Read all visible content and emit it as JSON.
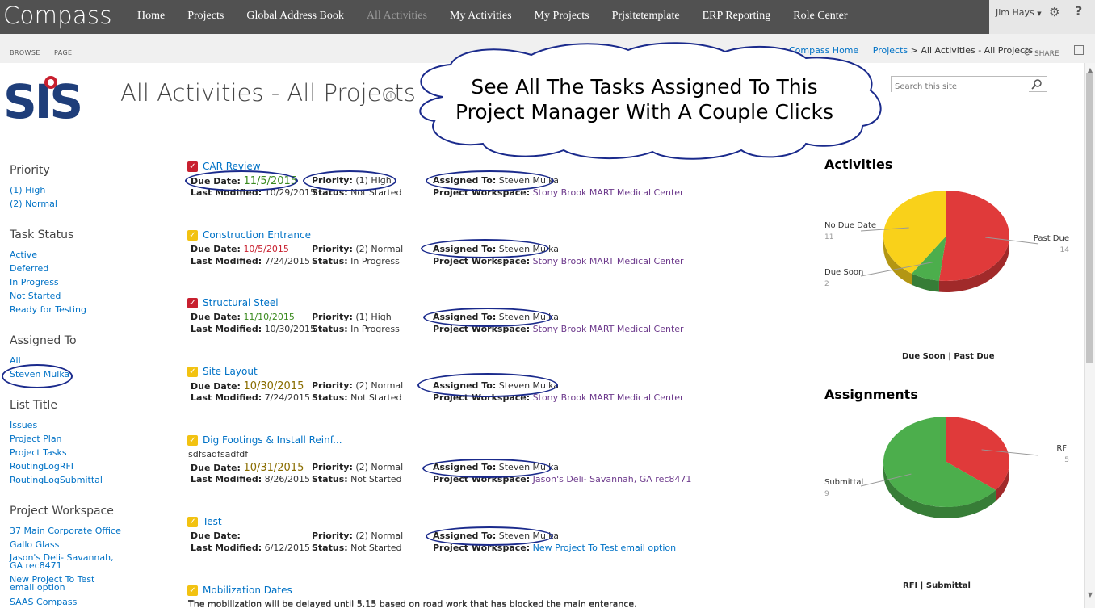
{
  "suite": {
    "brand": "Compass",
    "nav": [
      "Home",
      "Projects",
      "Global Address Book",
      "All Activities",
      "My Activities",
      "My Projects",
      "Prjsitetemplate",
      "ERP Reporting",
      "Role Center"
    ],
    "nav_active": "All Activities",
    "user": "Jim Hays",
    "help": "?"
  },
  "ribbon": {
    "tabs": [
      "BROWSE",
      "PAGE"
    ],
    "crumbs": [
      "Compass Home",
      "Projects",
      "All Activities - All Projects"
    ],
    "sep": ">",
    "share": "SHARE"
  },
  "header": {
    "logo_text": "SIS",
    "title": "All Activities - All Projects",
    "search_placeholder": "Search this site"
  },
  "callout": {
    "line1": "See All The Tasks Assigned To This",
    "line2": "Project Manager With A Couple Clicks"
  },
  "leftnav": {
    "sections": [
      {
        "title": "Priority",
        "items": [
          "(1) High",
          "(2) Normal"
        ]
      },
      {
        "title": "Task Status",
        "items": [
          "Active",
          "Deferred",
          "In Progress",
          "Not Started",
          "Ready for Testing"
        ]
      },
      {
        "title": "Assigned To",
        "items": [
          "All",
          "Steven Mulka"
        ]
      },
      {
        "title": "List Title",
        "items": [
          "Issues",
          "Project Plan",
          "Project Tasks",
          "RoutingLogRFI",
          "RoutingLogSubmittal"
        ]
      },
      {
        "title": "Project Workspace",
        "items": [
          "37 Main Corporate Office",
          "Gallo Glass",
          "Jason's Deli- Savannah, GA rec8471",
          "New Project To Test email option",
          "SAAS Compass"
        ]
      }
    ]
  },
  "labels": {
    "due": "Due Date:",
    "modified": "Last Modified:",
    "priority": "Priority:",
    "status": "Status:",
    "assigned": "Assigned To:",
    "workspace": "Project Workspace:"
  },
  "tasks": [
    {
      "title": "CAR Review",
      "due": "11/5/2015",
      "modified": "10/29/2015",
      "priority": "(1) High",
      "status": "Not Started",
      "assigned": "Steven Mulka",
      "workspace": "Stony Brook MART Medical Center",
      "desc": ""
    },
    {
      "title": "Construction Entrance",
      "due": "10/5/2015",
      "modified": "7/24/2015",
      "priority": "(2) Normal",
      "status": "In Progress",
      "assigned": "Steven Mulka",
      "workspace": "Stony Brook MART Medical Center",
      "desc": ""
    },
    {
      "title": "Structural Steel",
      "due": "11/10/2015",
      "modified": "10/30/2015",
      "priority": "(1) High",
      "status": "In Progress",
      "assigned": "Steven Mulka",
      "workspace": "Stony Brook MART Medical Center",
      "desc": ""
    },
    {
      "title": "Site Layout",
      "due": "10/30/2015",
      "modified": "7/24/2015",
      "priority": "(2) Normal",
      "status": "Not Started",
      "assigned": "Steven Mulka",
      "workspace": "Stony Brook MART Medical Center",
      "desc": ""
    },
    {
      "title": "Dig Footings & Install Reinf...",
      "due": "10/31/2015",
      "modified": "8/26/2015",
      "priority": "(2) Normal",
      "status": "Not Started",
      "assigned": "Steven Mulka",
      "workspace": "Jason's Deli- Savannah, GA rec8471",
      "desc": "sdfsadfsadfdf"
    },
    {
      "title": "Test",
      "due": "",
      "modified": "6/12/2015",
      "priority": "(2) Normal",
      "status": "Not Started",
      "assigned": "Steven Mulka",
      "workspace": "New Project To Test email option",
      "desc": ""
    },
    {
      "title": "Mobilization Dates",
      "due": "",
      "modified": "",
      "priority": "",
      "status": "",
      "assigned": "",
      "workspace": "",
      "desc": "The mobilization will be delayed until 5.15 based on road work that has blocked the main enterance."
    }
  ],
  "chart_data": [
    {
      "type": "pie",
      "title": "Activities",
      "caption": "Due Soon | Past Due",
      "slices": [
        {
          "name": "Past Due",
          "value": 14,
          "color": "#e03a3a"
        },
        {
          "name": "Due Soon",
          "value": 2,
          "color": "#4cae4c"
        },
        {
          "name": "No Due Date",
          "value": 11,
          "color": "#f9d11a"
        }
      ]
    },
    {
      "type": "pie",
      "title": "Assignments",
      "caption": "RFI | Submittal",
      "slices": [
        {
          "name": "RFI",
          "value": 5,
          "color": "#e03a3a"
        },
        {
          "name": "Submittal",
          "value": 9,
          "color": "#4cae4c"
        }
      ]
    }
  ],
  "colors": {
    "suitebar": "#515151",
    "link": "#0072c6",
    "annotation": "#1a2a8c"
  }
}
